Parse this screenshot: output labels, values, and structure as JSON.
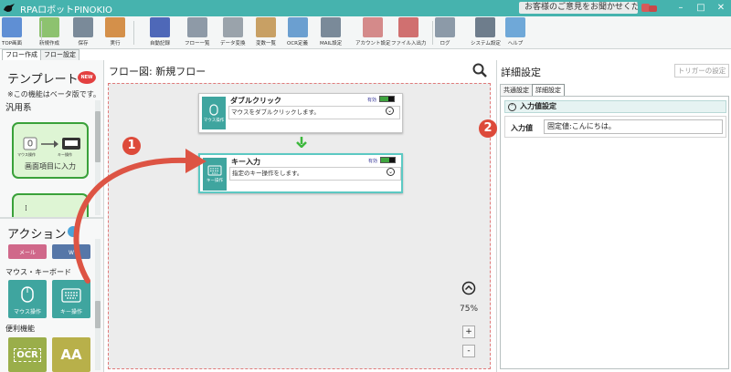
{
  "app": {
    "title": "RPAロボットPINOKIO",
    "feedback": "お客様のご意見をお聞かせください"
  },
  "window": {
    "minimize": "–",
    "maximize": "□",
    "close": "✕"
  },
  "toolbar": [
    {
      "label": "TOP画面",
      "icon": "home-icon",
      "color": "#5f8fd4"
    },
    {
      "label": "新規作成",
      "icon": "new-file-icon",
      "color": "#8dc26f"
    },
    {
      "label": "保存",
      "icon": "save-icon",
      "color": "#7a8a99"
    },
    {
      "label": "実行",
      "icon": "play-icon",
      "color": "#d4904a"
    },
    {
      "label": "自動記録",
      "icon": "record-icon",
      "color": "#4e68b8"
    },
    {
      "label": "フロー一覧",
      "icon": "flow-list-icon",
      "color": "#8e9aa7"
    },
    {
      "label": "データ変換",
      "icon": "data-convert-icon",
      "color": "#9aa3ab"
    },
    {
      "label": "変数一覧",
      "icon": "variable-icon",
      "color": "#c8a064"
    },
    {
      "label": "OCR定義",
      "icon": "ocr-icon",
      "color": "#6b9fd0"
    },
    {
      "label": "MAIL設定",
      "icon": "mail-icon",
      "color": "#7a8a99"
    },
    {
      "label": "アカウント設定",
      "icon": "account-icon",
      "color": "#d48a8a"
    },
    {
      "label": "ファイル入出力",
      "icon": "file-io-icon",
      "color": "#d07070"
    },
    {
      "label": "ログ",
      "icon": "log-icon",
      "color": "#8c9aa8"
    },
    {
      "label": "システム設定",
      "icon": "gear-icon",
      "color": "#6e7d8c"
    },
    {
      "label": "ヘルプ",
      "icon": "help-icon",
      "color": "#6fa8d8"
    }
  ],
  "tabs": [
    "フロー作成",
    "フロー設定"
  ],
  "left": {
    "template_title": "テンプレート",
    "new_badge": "NEW",
    "beta_note": "※この機能はベータ版です。",
    "group_general": "汎用系",
    "template_card_label": "画面項目に入力",
    "template_mouse": "マウス操作",
    "template_key": "キー操作",
    "action_title": "アクション",
    "actions_top": [
      {
        "label": "メール",
        "color": "#d0688a"
      },
      {
        "label": "W",
        "color": "#5677a8"
      }
    ],
    "group_mouse_kb": "マウス・キーボード",
    "actions_mouse_kb": [
      {
        "label": "マウス操作",
        "icon": "mouse-icon",
        "color": "#3fa59f"
      },
      {
        "label": "キー操作",
        "icon": "keyboard-icon",
        "color": "#3fa59f"
      }
    ],
    "group_util": "便利機能",
    "actions_util": [
      {
        "label": "OCR",
        "icon": "ocr-icon",
        "color": "#9aae4a"
      },
      {
        "label": "AA",
        "icon": "text-icon",
        "color": "#b8b04a"
      }
    ]
  },
  "flow": {
    "title": "フロー図:  新規フロー",
    "nodes": [
      {
        "title": "ダブルクリック",
        "icon_label": "マウス操作",
        "status": "有効",
        "desc": "マウスをダブルクリックします。"
      },
      {
        "title": "キー入力",
        "icon_label": "キー操作",
        "status": "有効",
        "desc": "指定のキー操作をします。"
      }
    ],
    "zoom": "75%",
    "zoom_in": "+",
    "zoom_out": "-"
  },
  "right": {
    "title": "詳細設定",
    "trigger_button": "トリガーの設定",
    "tabs": [
      "共通設定",
      "詳細設定"
    ],
    "section": "入力値設定",
    "input_label": "入力値",
    "input_value": "固定値:こんにちは。"
  },
  "callouts": [
    "1",
    "2"
  ],
  "colors": {
    "accent": "#46b3ae",
    "node_icon": "#3fa59f",
    "callout": "#dd4a3a",
    "arrow_down": "#3db83d",
    "template_border": "#3aa13a"
  }
}
